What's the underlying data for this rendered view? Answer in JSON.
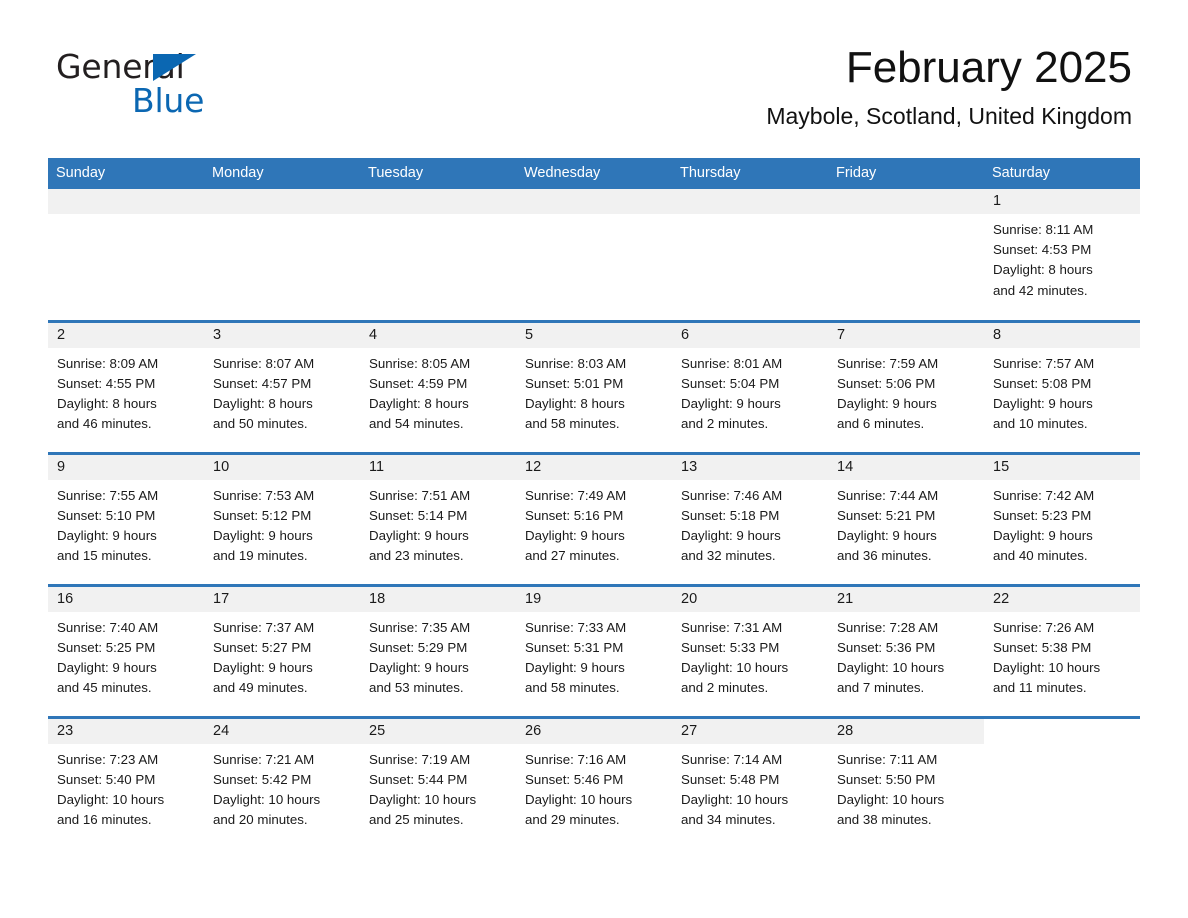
{
  "brand": {
    "name_part1": "General",
    "name_part2": "Blue",
    "accent_color": "#0b67b2"
  },
  "header": {
    "title": "February 2025",
    "subtitle": "Maybole, Scotland, United Kingdom"
  },
  "theme": {
    "header_blue": "#2f76b8",
    "daynum_gray": "#f1f1f1",
    "text": "#1a1a1a"
  },
  "weekday_headers": [
    "Sunday",
    "Monday",
    "Tuesday",
    "Wednesday",
    "Thursday",
    "Friday",
    "Saturday"
  ],
  "weeks": [
    [
      {
        "day": "",
        "lines": []
      },
      {
        "day": "",
        "lines": []
      },
      {
        "day": "",
        "lines": []
      },
      {
        "day": "",
        "lines": []
      },
      {
        "day": "",
        "lines": []
      },
      {
        "day": "",
        "lines": []
      },
      {
        "day": "1",
        "lines": [
          "Sunrise: 8:11 AM",
          "Sunset: 4:53 PM",
          "Daylight: 8 hours",
          "and 42 minutes."
        ]
      }
    ],
    [
      {
        "day": "2",
        "lines": [
          "Sunrise: 8:09 AM",
          "Sunset: 4:55 PM",
          "Daylight: 8 hours",
          "and 46 minutes."
        ]
      },
      {
        "day": "3",
        "lines": [
          "Sunrise: 8:07 AM",
          "Sunset: 4:57 PM",
          "Daylight: 8 hours",
          "and 50 minutes."
        ]
      },
      {
        "day": "4",
        "lines": [
          "Sunrise: 8:05 AM",
          "Sunset: 4:59 PM",
          "Daylight: 8 hours",
          "and 54 minutes."
        ]
      },
      {
        "day": "5",
        "lines": [
          "Sunrise: 8:03 AM",
          "Sunset: 5:01 PM",
          "Daylight: 8 hours",
          "and 58 minutes."
        ]
      },
      {
        "day": "6",
        "lines": [
          "Sunrise: 8:01 AM",
          "Sunset: 5:04 PM",
          "Daylight: 9 hours",
          "and 2 minutes."
        ]
      },
      {
        "day": "7",
        "lines": [
          "Sunrise: 7:59 AM",
          "Sunset: 5:06 PM",
          "Daylight: 9 hours",
          "and 6 minutes."
        ]
      },
      {
        "day": "8",
        "lines": [
          "Sunrise: 7:57 AM",
          "Sunset: 5:08 PM",
          "Daylight: 9 hours",
          "and 10 minutes."
        ]
      }
    ],
    [
      {
        "day": "9",
        "lines": [
          "Sunrise: 7:55 AM",
          "Sunset: 5:10 PM",
          "Daylight: 9 hours",
          "and 15 minutes."
        ]
      },
      {
        "day": "10",
        "lines": [
          "Sunrise: 7:53 AM",
          "Sunset: 5:12 PM",
          "Daylight: 9 hours",
          "and 19 minutes."
        ]
      },
      {
        "day": "11",
        "lines": [
          "Sunrise: 7:51 AM",
          "Sunset: 5:14 PM",
          "Daylight: 9 hours",
          "and 23 minutes."
        ]
      },
      {
        "day": "12",
        "lines": [
          "Sunrise: 7:49 AM",
          "Sunset: 5:16 PM",
          "Daylight: 9 hours",
          "and 27 minutes."
        ]
      },
      {
        "day": "13",
        "lines": [
          "Sunrise: 7:46 AM",
          "Sunset: 5:18 PM",
          "Daylight: 9 hours",
          "and 32 minutes."
        ]
      },
      {
        "day": "14",
        "lines": [
          "Sunrise: 7:44 AM",
          "Sunset: 5:21 PM",
          "Daylight: 9 hours",
          "and 36 minutes."
        ]
      },
      {
        "day": "15",
        "lines": [
          "Sunrise: 7:42 AM",
          "Sunset: 5:23 PM",
          "Daylight: 9 hours",
          "and 40 minutes."
        ]
      }
    ],
    [
      {
        "day": "16",
        "lines": [
          "Sunrise: 7:40 AM",
          "Sunset: 5:25 PM",
          "Daylight: 9 hours",
          "and 45 minutes."
        ]
      },
      {
        "day": "17",
        "lines": [
          "Sunrise: 7:37 AM",
          "Sunset: 5:27 PM",
          "Daylight: 9 hours",
          "and 49 minutes."
        ]
      },
      {
        "day": "18",
        "lines": [
          "Sunrise: 7:35 AM",
          "Sunset: 5:29 PM",
          "Daylight: 9 hours",
          "and 53 minutes."
        ]
      },
      {
        "day": "19",
        "lines": [
          "Sunrise: 7:33 AM",
          "Sunset: 5:31 PM",
          "Daylight: 9 hours",
          "and 58 minutes."
        ]
      },
      {
        "day": "20",
        "lines": [
          "Sunrise: 7:31 AM",
          "Sunset: 5:33 PM",
          "Daylight: 10 hours",
          "and 2 minutes."
        ]
      },
      {
        "day": "21",
        "lines": [
          "Sunrise: 7:28 AM",
          "Sunset: 5:36 PM",
          "Daylight: 10 hours",
          "and 7 minutes."
        ]
      },
      {
        "day": "22",
        "lines": [
          "Sunrise: 7:26 AM",
          "Sunset: 5:38 PM",
          "Daylight: 10 hours",
          "and 11 minutes."
        ]
      }
    ],
    [
      {
        "day": "23",
        "lines": [
          "Sunrise: 7:23 AM",
          "Sunset: 5:40 PM",
          "Daylight: 10 hours",
          "and 16 minutes."
        ]
      },
      {
        "day": "24",
        "lines": [
          "Sunrise: 7:21 AM",
          "Sunset: 5:42 PM",
          "Daylight: 10 hours",
          "and 20 minutes."
        ]
      },
      {
        "day": "25",
        "lines": [
          "Sunrise: 7:19 AM",
          "Sunset: 5:44 PM",
          "Daylight: 10 hours",
          "and 25 minutes."
        ]
      },
      {
        "day": "26",
        "lines": [
          "Sunrise: 7:16 AM",
          "Sunset: 5:46 PM",
          "Daylight: 10 hours",
          "and 29 minutes."
        ]
      },
      {
        "day": "27",
        "lines": [
          "Sunrise: 7:14 AM",
          "Sunset: 5:48 PM",
          "Daylight: 10 hours",
          "and 34 minutes."
        ]
      },
      {
        "day": "28",
        "lines": [
          "Sunrise: 7:11 AM",
          "Sunset: 5:50 PM",
          "Daylight: 10 hours",
          "and 38 minutes."
        ]
      },
      {
        "day": "",
        "lines": []
      }
    ]
  ]
}
